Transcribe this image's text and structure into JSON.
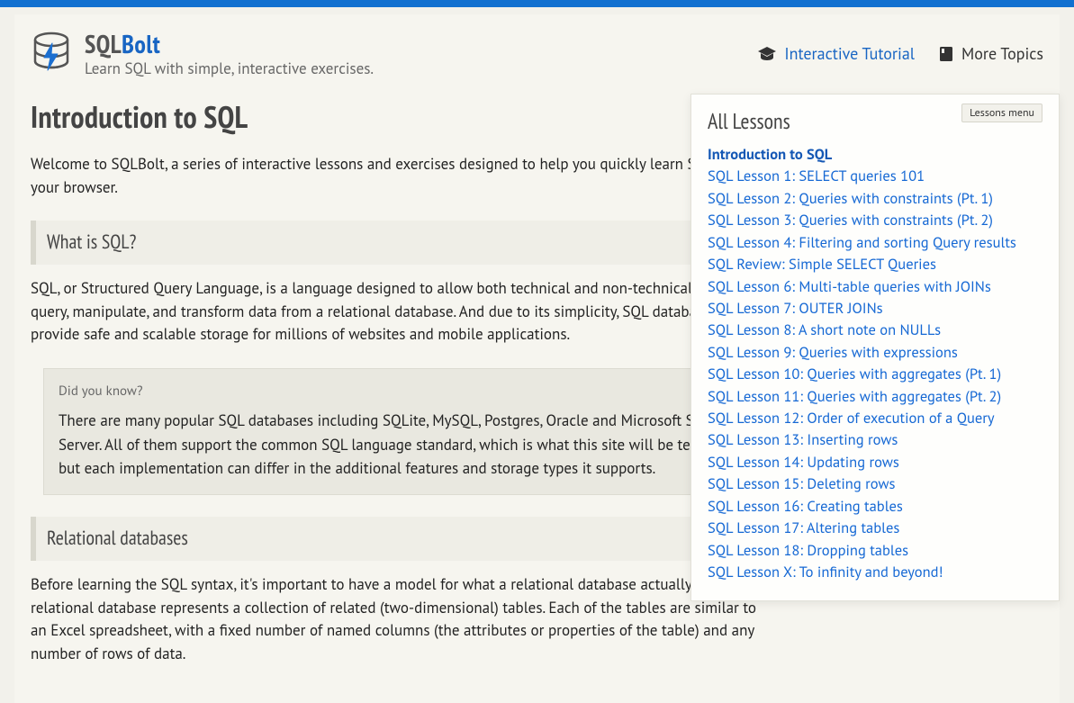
{
  "site": {
    "title_prefix": "SQL",
    "title_suffix": "Bolt",
    "tagline": "Learn SQL with simple, interactive exercises."
  },
  "nav": {
    "tutorial": "Interactive Tutorial",
    "more_topics": "More Topics"
  },
  "page": {
    "title": "Introduction to SQL",
    "intro": "Welcome to SQLBolt, a series of interactive lessons and exercises designed to help you quickly learn SQL right in your browser.",
    "section1_title": "What is SQL?",
    "section1_body": "SQL, or Structured Query Language, is a language designed to allow both technical and non-technical users query, manipulate, and transform data from a relational database. And due to its simplicity, SQL databases provide safe and scalable storage for millions of websites and mobile applications.",
    "dyk_title": "Did you know?",
    "dyk_body": "There are many popular SQL databases including SQLite, MySQL, Postgres, Oracle and Microsoft SQL Server. All of them support the common SQL language standard, which is what this site will be teaching, but each implementation can differ in the additional features and storage types it supports.",
    "section2_title": "Relational databases",
    "section2_body": "Before learning the SQL syntax, it's important to have a model for what a relational database actually is. A relational database represents a collection of related (two-dimensional) tables. Each of the tables are similar to an Excel spreadsheet, with a fixed number of named columns (the attributes or properties of the table) and any number of rows of data."
  },
  "lessons_panel": {
    "title": "All Lessons",
    "badge": "Lessons menu",
    "items": [
      "Introduction to SQL",
      "SQL Lesson 1: SELECT queries 101",
      "SQL Lesson 2: Queries with constraints (Pt. 1)",
      "SQL Lesson 3: Queries with constraints (Pt. 2)",
      "SQL Lesson 4: Filtering and sorting Query results",
      "SQL Review: Simple SELECT Queries",
      "SQL Lesson 6: Multi-table queries with JOINs",
      "SQL Lesson 7: OUTER JOINs",
      "SQL Lesson 8: A short note on NULLs",
      "SQL Lesson 9: Queries with expressions",
      "SQL Lesson 10: Queries with aggregates (Pt. 1)",
      "SQL Lesson 11: Queries with aggregates (Pt. 2)",
      "SQL Lesson 12: Order of execution of a Query",
      "SQL Lesson 13: Inserting rows",
      "SQL Lesson 14: Updating rows",
      "SQL Lesson 15: Deleting rows",
      "SQL Lesson 16: Creating tables",
      "SQL Lesson 17: Altering tables",
      "SQL Lesson 18: Dropping tables",
      "SQL Lesson X: To infinity and beyond!"
    ]
  }
}
